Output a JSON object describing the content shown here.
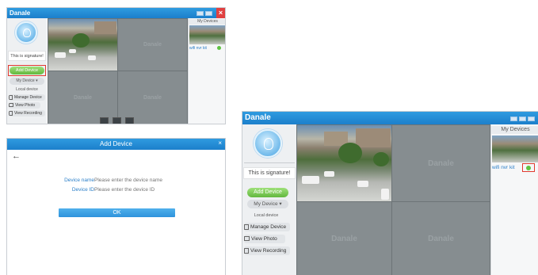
{
  "app": {
    "title": "Danale",
    "watermark": "Danale"
  },
  "sidebar": {
    "signature": "This is signature!",
    "add_device": "Add Device",
    "my_device": "My Device",
    "local_device": "Local device",
    "manage_device": "Manage Device",
    "view_photo": "View Photo",
    "view_recording": "View Recording"
  },
  "devices_panel": {
    "title": "My Devices",
    "device_name": "wifi nvr kit",
    "status_color": "#5fc342"
  },
  "dialog": {
    "title": "Add Device",
    "back_arrow": "←",
    "close": "×",
    "name_label": "Device name",
    "name_placeholder": "Please enter the device name",
    "id_label": "Device ID",
    "id_placeholder": "Please enter the device ID",
    "ok_label": "OK"
  },
  "colors": {
    "accent": "#1c7fcb",
    "add_button": "#63b83f",
    "highlight": "#e03a2f"
  }
}
